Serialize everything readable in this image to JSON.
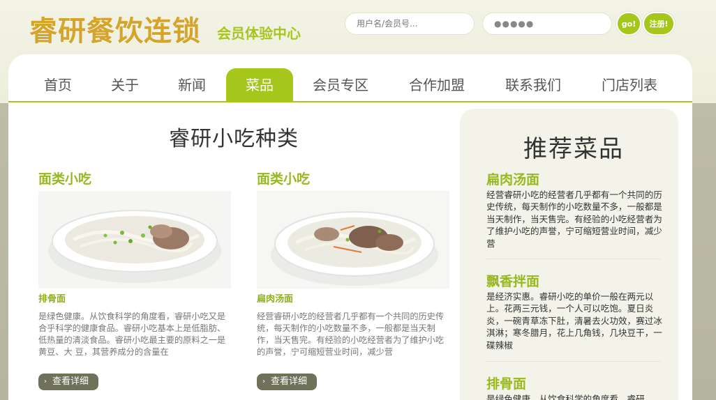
{
  "header": {
    "logo_text": "睿研餐饮连锁",
    "logo_sub": "会员体验中心",
    "username_placeholder": "用户名/会员号...",
    "password_value": "●●●●●",
    "go_label": "go!",
    "register_label": "注册!"
  },
  "nav": {
    "items": [
      {
        "label": "首页"
      },
      {
        "label": "关于"
      },
      {
        "label": "新闻"
      },
      {
        "label": "菜品",
        "active": true
      },
      {
        "label": "会员专区"
      },
      {
        "label": "合作加盟"
      },
      {
        "label": "联系我们"
      },
      {
        "label": "门店列表"
      }
    ]
  },
  "main": {
    "section_title": "睿研小吃种类",
    "cards": [
      {
        "category": "面类小吃",
        "name": "排骨面",
        "description": "是绿色健康。从饮食科学的角度看，睿研小吃又是合乎科学的健康食品。睿研小吃基本上是低脂肪、低热量的清淡食品。睿研小吃最主要的原料之一是黄豆、大 豆，其营养成分的含量在",
        "button_label": "查看详细"
      },
      {
        "category": "面类小吃",
        "name": "扁肉汤面",
        "description": "经营睿研小吃的经营者几乎都有一个共同的历史传统，每天制作的小吃数量不多，一般都是当天制作，当天售完。有经验的小吃经营者为了维护小吃的声誉，宁可缩短营业时间，减少营",
        "button_label": "查看详细"
      }
    ]
  },
  "sidebar": {
    "title": "推荐菜品",
    "items": [
      {
        "title": "扁肉汤面",
        "description": "经营睿研小吃的经营者几乎都有一个共同的历史传统，每天制作的小吃数量不多，一般都是当天制作，当天售完。有经验的小吃经营者为了维护小吃的声誉，宁可缩短营业时间，减少营"
      },
      {
        "title": "飘香拌面",
        "description": "是经济实惠。睿研小吃的单价一般在两元以上。花两三元钱，一个人可以吃饱。夏日炎炎，一碗青草冻下肚，清暑去火功效，赛过冰淇淋；寒冬腊月，花上几角钱，几块豆干，一碟辣椒"
      },
      {
        "title": "排骨面",
        "description": "是绿色健康。从饮食科学的角度看，睿研"
      }
    ]
  },
  "colors": {
    "accent": "#a5c71c",
    "logo": "#d4a52a",
    "button_dark": "#6f7159"
  }
}
